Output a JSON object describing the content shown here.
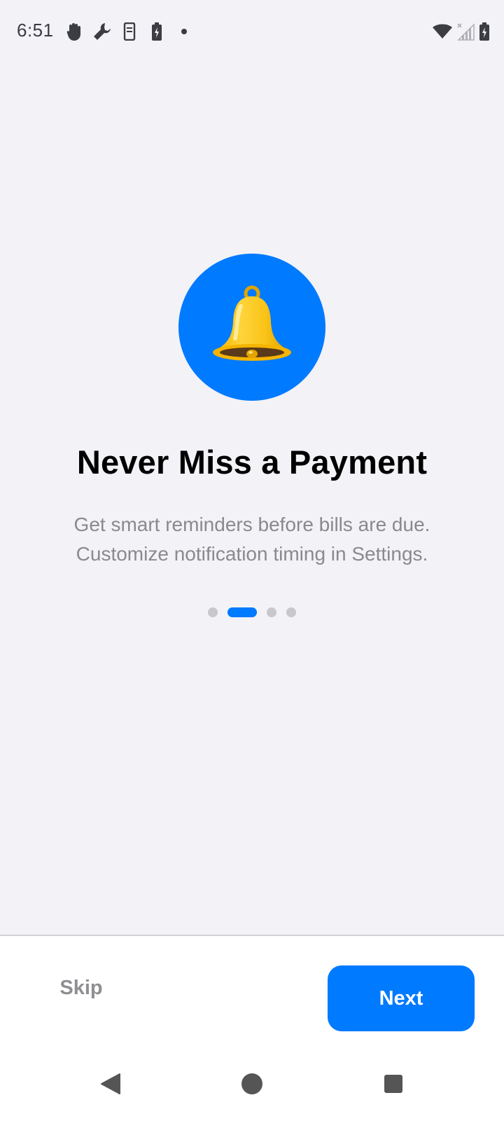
{
  "status_bar": {
    "time": "6:51",
    "left_icons": [
      "hand-icon",
      "wrench-icon",
      "phone-icon",
      "battery-saver-icon",
      "dot-icon"
    ],
    "right_icons": [
      "wifi-icon",
      "signal-icon",
      "battery-icon"
    ]
  },
  "onboarding": {
    "icon": "bell-icon",
    "accent_color": "#007AFF",
    "title": "Never Miss a Payment",
    "subtitle_lines": [
      "Get smart reminders before bills are due.",
      "Customize notification timing in Settings."
    ],
    "pager": {
      "total_pages": 4,
      "current_page": 2
    }
  },
  "actions": {
    "skip_label": "Skip",
    "next_label": "Next"
  },
  "nav_bar": {
    "buttons": [
      "back-icon",
      "home-icon",
      "recents-icon"
    ]
  }
}
